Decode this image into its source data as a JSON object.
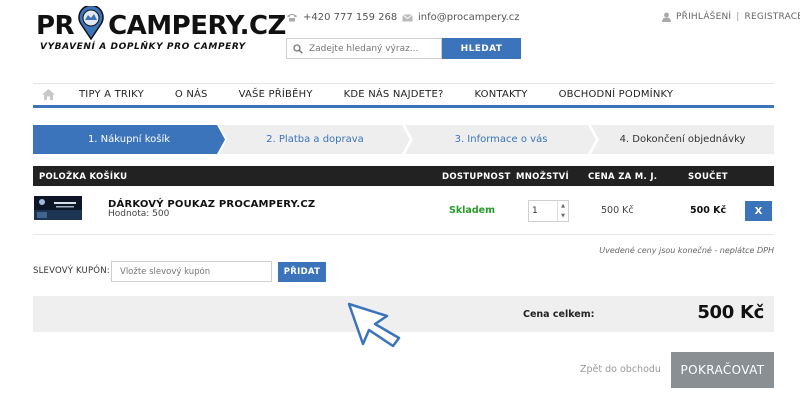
{
  "header": {
    "logo_text_prefix": "PR",
    "logo_text_suffix": "CAMPERY.CZ",
    "logo_tagline": "VYBAVENÍ A DOPLŇKY PRO CAMPERY",
    "phone": "+420 777 159 268",
    "email": "info@procampery.cz",
    "login_label": "PŘIHLÁŠENÍ",
    "auth_separator": "|",
    "register_label": "REGISTRACE",
    "search_placeholder": "Zadejte hledaný výraz...",
    "search_button": "HLEDAT"
  },
  "nav": {
    "items": [
      "TIPY A TRIKY",
      "O NÁS",
      "VAŠE PŘÍBĚHY",
      "KDE NÁS NAJDETE?",
      "KONTAKTY",
      "OBCHODNÍ PODMÍNKY"
    ]
  },
  "steps": [
    {
      "label": "1. Nákupní košík",
      "active": true
    },
    {
      "label": "2. Platba a doprava",
      "active": false
    },
    {
      "label": "3. Informace o vás",
      "active": false
    },
    {
      "label": "4. Dokončení objednávky",
      "active": false
    }
  ],
  "cart": {
    "headers": {
      "item": "POLOŽKA KOŠÍKU",
      "availability": "DOSTUPNOST",
      "quantity": "MNOŽSTVÍ",
      "unit_price": "CENA ZA M. J.",
      "sum": "SOUČET"
    },
    "items": [
      {
        "name": "DÁRKOVÝ POUKAZ PROCAMPERY.CZ",
        "value": "Hodnota: 500",
        "availability": "Skladem",
        "quantity": "1",
        "unit_price": "500 Kč",
        "sum": "500 Kč",
        "remove_label": "X"
      }
    ],
    "vat_note": "Uvedené ceny jsou konečné - neplátce DPH"
  },
  "coupon": {
    "label": "SLEVOVÝ KUPÓN:",
    "placeholder": "Vložte slevový kupón",
    "button": "PŘIDAT"
  },
  "summary": {
    "label": "Cena celkem:",
    "value": "500 Kč"
  },
  "footer": {
    "back_link": "Zpět do obchodu",
    "continue_button": "POKRAČOVAT"
  },
  "colors": {
    "accent": "#3b74ba",
    "header_bar": "#222222",
    "stock_green": "#2a9a2a",
    "continue_gray": "#8a8f93"
  }
}
